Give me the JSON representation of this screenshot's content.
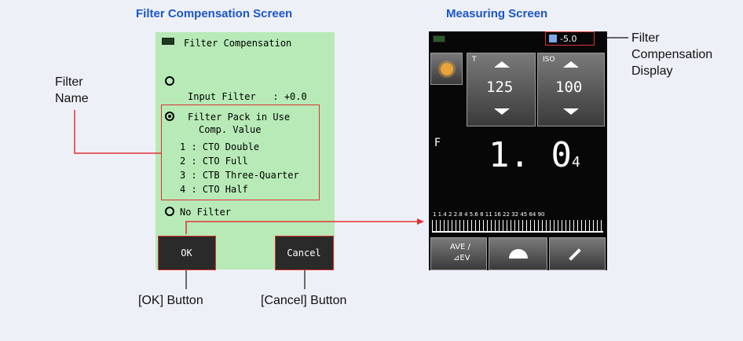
{
  "headings": {
    "filter_screen": "Filter Compensation Screen",
    "measuring_screen": "Measuring Screen"
  },
  "filter_screen": {
    "title": "Filter Compensation",
    "input_filter_line1": "Input Filter   : +0.0",
    "input_filter_line2": "Comp. Value",
    "filter_pack": "Filter Pack in Use",
    "filters": [
      "1 : CTO Double",
      "2 : CTO Full",
      "3 : CTB Three-Quarter",
      "4 : CTO Half"
    ],
    "no_filter": "No Filter",
    "ok_label": "OK",
    "cancel_label": "Cancel",
    "selected_option": "Filter Pack in Use"
  },
  "measuring_screen": {
    "compensation_value": "-5.0",
    "t_label": "T",
    "t_value": "125",
    "iso_label": "ISO",
    "iso_value": "100",
    "f_label": "F",
    "f_value": "1. 0",
    "f_subscript": "4",
    "scale": "1  1.4  2  2.8  4  5.6  8  11  16  22  32  45  64  90",
    "ave_label": "AVE /",
    "ev_label": "⊿EV"
  },
  "callouts": {
    "filter_name": [
      "Filter",
      "Name"
    ],
    "ok_button": "[OK] Button",
    "cancel_button": "[Cancel] Button",
    "filter_comp_display": [
      "Filter",
      "Compensation",
      "Display"
    ]
  },
  "colors": {
    "heading": "#1a56c8",
    "screen_bg": "#b7eab7",
    "highlight": "#dd3333",
    "background": "#eef0f8"
  }
}
